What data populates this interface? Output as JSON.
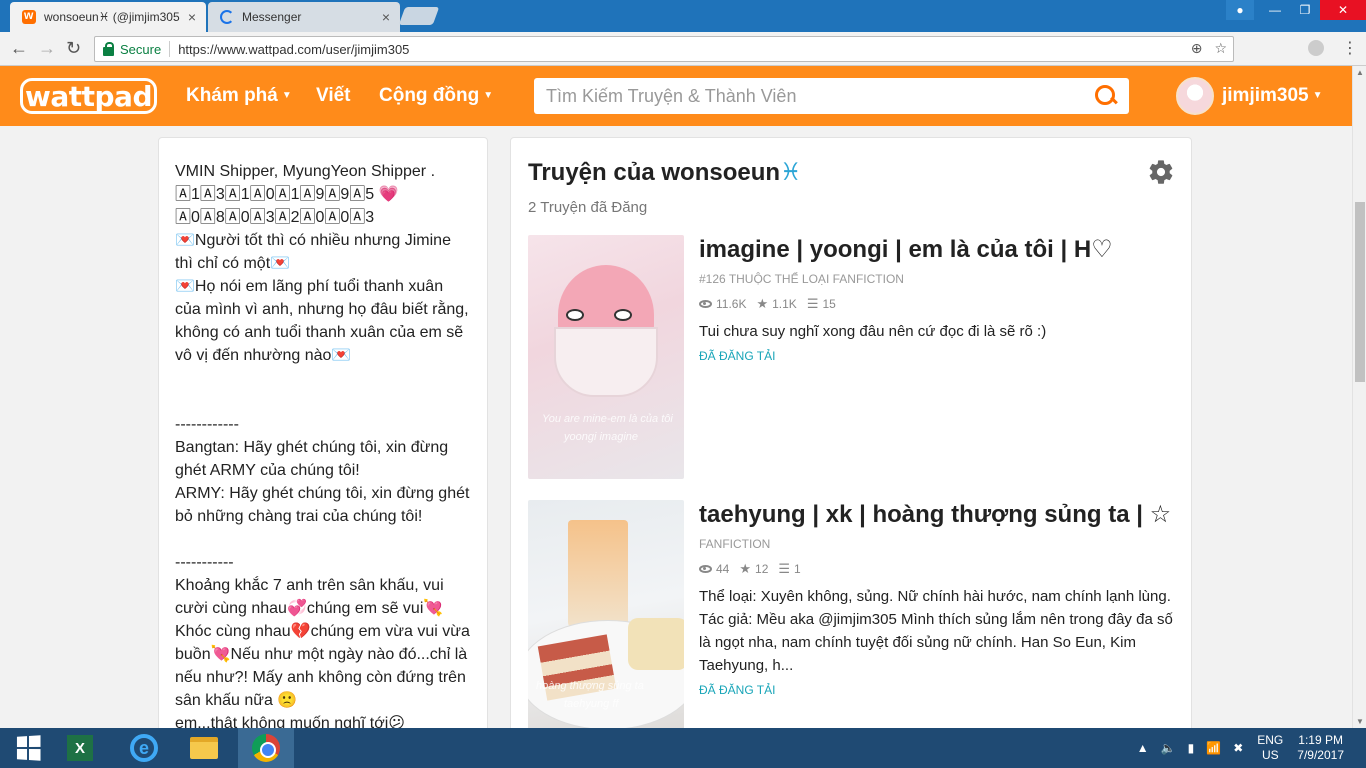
{
  "browser": {
    "tabs": [
      {
        "label": "wonsoeun♓ (@jimjim305"
      },
      {
        "label": "Messenger"
      }
    ],
    "tab_close": "×",
    "secure_label": "Secure",
    "url": "https://www.wattpad.com/user/jimjim305"
  },
  "header": {
    "logo": "wattpad",
    "nav": [
      "Khám phá",
      "Viết",
      "Cộng đồng"
    ],
    "search_placeholder": "Tìm Kiếm Truyện & Thành Viên",
    "username": "jimjim305"
  },
  "about": {
    "text": "VMIN Shipper, MyungYeon Shipper .\n🄰1🄰3🄰1🄰0🄰1🄰9🄰9🄰5 💗 🄰0🄰8🄰0🄰3🄰2🄰0🄰0🄰3\n💌Người tốt thì có nhiều nhưng Jimine thì chỉ có một💌\n💌Họ nói em lãng phí tuổi thanh xuân của mình vì anh, nhưng họ đâu biết rằng, không có anh tuổi thanh xuân của em sẽ vô vị đến nhường nào💌\n\n\n------------\nBangtan: Hãy ghét chúng tôi, xin đừng ghét ARMY của chúng tôi!\nARMY: Hãy ghét chúng tôi, xin đừng ghét bỏ những chàng trai của chúng tôi!\n\n-----------\nKhoảng khắc 7 anh trên sân khấu, vui cười cùng nhau💞chúng em sẽ vui💘\nKhóc cùng nhau💔chúng em vừa vui vừa buồn💘Nếu như một ngày nào đó...chỉ là nếu như?! Mấy anh không còn đứng trên sân khấu nữa 🙁\nem...thật không muốn nghĩ tới😕"
  },
  "stories_panel": {
    "title": "Truyện của wonsoeun",
    "title_symbol": "♓",
    "count": "2 Truyện đã Đăng",
    "items": [
      {
        "title": "imagine | yoongi | em là của tôi | H♡",
        "category": "#126 thuộc thể loại Fanfiction",
        "reads": "11.6K",
        "votes": "1.1K",
        "parts": "15",
        "description": "Tui chưa suy nghĩ xong đâu nên cứ đọc đi là sẽ rõ :)",
        "status": "Đã đăng tải",
        "cover_text": [
          "You are mine-em là của tôi",
          "yoongi imagine"
        ]
      },
      {
        "title": "taehyung | xk | hoàng thượng sủng ta | ☆",
        "category": "Fanfiction",
        "reads": "44",
        "votes": "12",
        "parts": "1",
        "description": "Thể loại: Xuyên không, sủng. Nữ chính hài hước, nam chính lạnh lùng. Tác giả: Mều aka @jimjim305 Mình thích sủng lắm nên trong đây đa số là ngọt nha, nam chính tuyệt đối sủng nữ chính. Han So Eun, Kim Taehyung, h...",
        "status": "Đã đăng tải",
        "cover_text": [
          "hoàng thượng sủng ta",
          "taehyung ff"
        ]
      }
    ]
  },
  "taskbar": {
    "lang": [
      "ENG",
      "US"
    ],
    "time": "1:19 PM",
    "date": "7/9/2017"
  },
  "colors": {
    "brand": "#ff8b1a",
    "taskbar": "#1f4a73",
    "link": "#18a5b8"
  }
}
